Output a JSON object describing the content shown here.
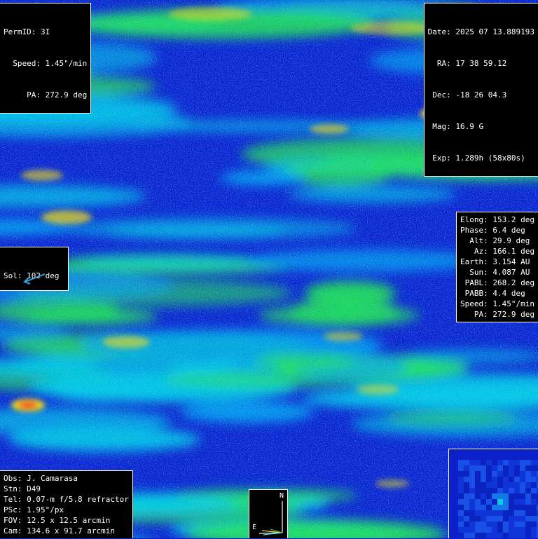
{
  "target": {
    "permid_label": "PermID:",
    "permid": "3I",
    "speed_label": "Speed:",
    "speed": "1.45\"/min",
    "pa_label": "PA:",
    "pa": "272.9 deg"
  },
  "observation": {
    "date_label": "Date:",
    "date": "2025 07 13.889193",
    "ra_label": "RA:",
    "ra": "17 38 59.12",
    "dec_label": "Dec:",
    "dec": "-18 26 04.3",
    "mag_label": "Mag:",
    "mag": "16.9 G",
    "exp_label": "Exp:",
    "exp": "1.289h (58x80s)"
  },
  "sol": {
    "label": "Sol:",
    "value": "102 deg"
  },
  "geometry": [
    {
      "label": "Elong:",
      "value": "153.2 deg"
    },
    {
      "label": "Phase:",
      "value": "6.4 deg"
    },
    {
      "label": "Alt:",
      "value": "29.9 deg"
    },
    {
      "label": "Az:",
      "value": "166.1 deg"
    },
    {
      "label": "Earth:",
      "value": "3.154 AU"
    },
    {
      "label": "Sun:",
      "value": "4.087 AU"
    },
    {
      "label": "PABL:",
      "value": "268.2 deg"
    },
    {
      "label": "PABB:",
      "value": "4.4 deg"
    },
    {
      "label": "Speed:",
      "value": "1.45\"/min"
    },
    {
      "label": "PA:",
      "value": "272.9 deg"
    }
  ],
  "observer": [
    {
      "label": "Obs:",
      "value": "J. Camarasa"
    },
    {
      "label": "Stn:",
      "value": "D49"
    },
    {
      "label": "Tel:",
      "value": "0.07-m f/5.8 refractor"
    },
    {
      "label": "PSc:",
      "value": "1.95\"/px"
    },
    {
      "label": "FOV:",
      "value": "12.5 x 12.5 arcmin"
    },
    {
      "label": "Cam:",
      "value": "134.6 x 91.7 arcmin"
    }
  ],
  "compass": {
    "north_label": "N",
    "east_label": "E"
  },
  "colors": {
    "sky_low": "#0a1fd0",
    "sky_mid": "#00c8e6",
    "sky_high": "#20e050",
    "glow": "#ffe000",
    "peak": "#ff2010",
    "sol_arrow": "#3aa0e0"
  }
}
